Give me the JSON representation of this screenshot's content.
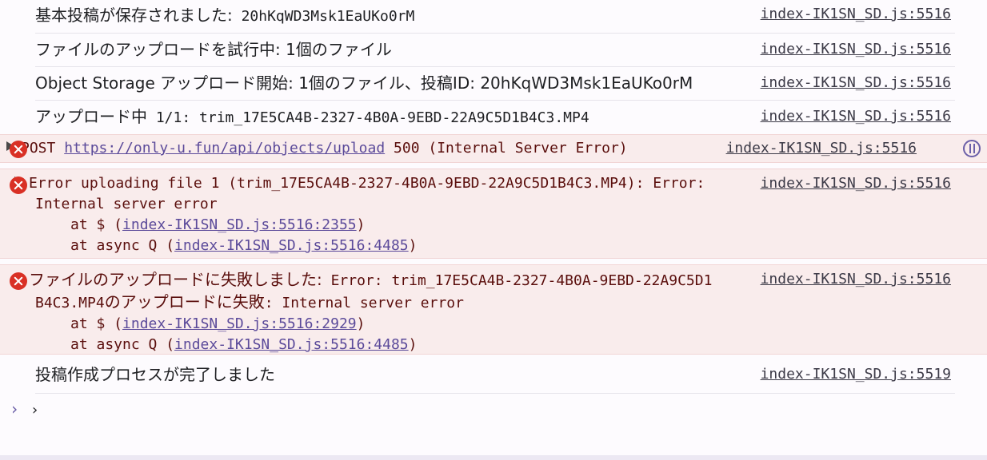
{
  "logs": [
    {
      "jp": "基本投稿が保存されました:",
      "text": " 20hKqWD3Msk1EaUKo0rM",
      "source": "index-IK1SN_SD.js:5516"
    },
    {
      "jp": "ファイルのアップロードを試行中:",
      "text": " 1個のファイル",
      "source": "index-IK1SN_SD.js:5516"
    },
    {
      "jp": "Object Storage アップロード開始:",
      "text": " 1個のファイル、投稿ID: 20hKqWD3Msk1EaUKo0rM",
      "source": "index-IK1SN_SD.js:5516"
    },
    {
      "jp": "アップロード中",
      "text": " 1/1: trim_17E5CA4B-2327-4B0A-9EBD-22A9C5D1B4C3.MP4",
      "source": "index-IK1SN_SD.js:5516"
    }
  ],
  "error_post": {
    "method": "POST",
    "url": "https://only-u.fun/api/objects/upload",
    "status": "500 (Internal Server Error)",
    "source": "index-IK1SN_SD.js:5516"
  },
  "error_upload": {
    "text": "Error uploading file 1 (trim_17E5CA4B-2327-4B0A-9EBD-22A9C5D1B4C3.MP4): Error: Internal server error",
    "stack1_prefix": "at $ (",
    "stack1_link": "index-IK1SN_SD.js:5516:2355",
    "stack2_prefix": "at async Q (",
    "stack2_link": "index-IK1SN_SD.js:5516:4485",
    "suffix": ")",
    "source": "index-IK1SN_SD.js:5516"
  },
  "error_failed": {
    "jp": "ファイルのアップロードに失敗しました:",
    "text": " Error: trim_17E5CA4B-2327-4B0A-9EBD-22A9C5D1B4C3.MP4",
    "jp2": "のアップロードに失敗",
    "text2": ": Internal server error",
    "stack1_prefix": "at $ (",
    "stack1_link": "index-IK1SN_SD.js:5516:2929",
    "stack2_prefix": "at async Q (",
    "stack2_link": "index-IK1SN_SD.js:5516:4485",
    "suffix": ")",
    "source": "index-IK1SN_SD.js:5516"
  },
  "final_log": {
    "jp": "投稿作成プロセスが完了しました",
    "source": "index-IK1SN_SD.js:5519"
  },
  "prompt": {
    "chevron": "›",
    "caret": "›"
  }
}
